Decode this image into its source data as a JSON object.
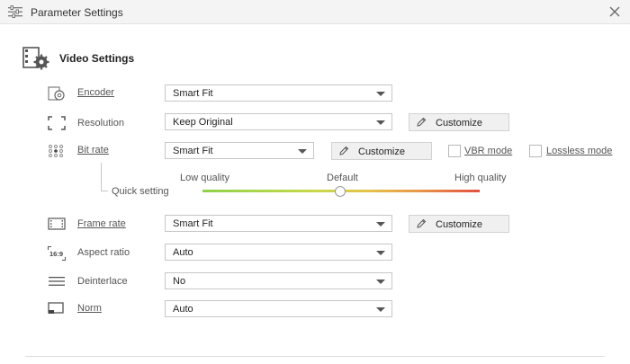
{
  "window": {
    "title": "Parameter Settings"
  },
  "section": {
    "title": "Video Settings"
  },
  "encoder": {
    "label": "Encoder",
    "value": "Smart Fit"
  },
  "resolution": {
    "label": "Resolution",
    "value": "Keep Original",
    "button": "Customize"
  },
  "bitrate": {
    "label": "Bit rate",
    "value": "Smart Fit",
    "button": "Customize",
    "vbr_label": "VBR mode",
    "lossless_label": "Lossless mode",
    "vbr_checked": false,
    "lossless_checked": false
  },
  "quick": {
    "label": "Quick setting",
    "low": "Low quality",
    "default": "Default",
    "high": "High quality"
  },
  "framerate": {
    "label": "Frame rate",
    "value": "Smart Fit",
    "button": "Customize"
  },
  "aspect": {
    "label": "Aspect ratio",
    "value": "Auto",
    "icon_text": "16:9"
  },
  "deinterlace": {
    "label": "Deinterlace",
    "value": "No"
  },
  "norm": {
    "label": "Norm",
    "value": "Auto"
  }
}
